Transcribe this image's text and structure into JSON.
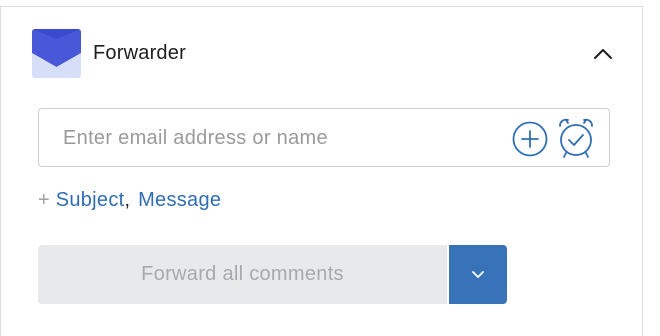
{
  "plugin": {
    "title": "Forwarder",
    "logo_icon": "envelope-logo-icon",
    "collapse_icon": "chevron-up-icon"
  },
  "recipient": {
    "value": "",
    "placeholder": "Enter email address or name",
    "add_icon": "plus-circle-icon",
    "schedule_icon": "alarm-clock-icon"
  },
  "extras": {
    "prefix_icon": "plus-icon",
    "subject_label": "Subject",
    "separator": ",",
    "message_label": "Message"
  },
  "actions": {
    "forward_label": "Forward all comments",
    "forward_enabled": false,
    "dropdown_icon": "chevron-down-icon"
  },
  "colors": {
    "accent": "#3873b9",
    "link": "#2f6db5",
    "disabled_bg": "#e8e9eb",
    "disabled_text": "#a7a9ac",
    "logo_dark": "#3c4fc2",
    "logo_light": "#c9d2f3"
  }
}
